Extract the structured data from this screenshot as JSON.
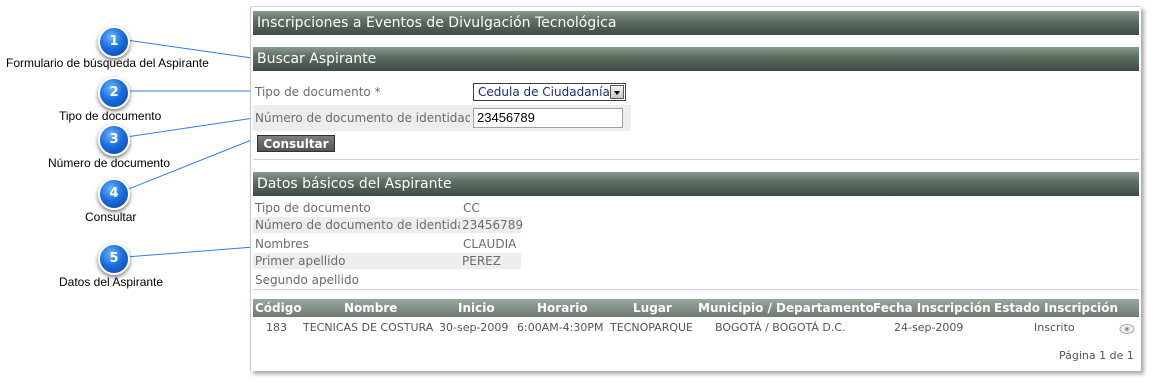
{
  "callouts": [
    {
      "number": "1",
      "caption": "Formulario de búsqueda del Aspirante"
    },
    {
      "number": "2",
      "caption": "Tipo de documento"
    },
    {
      "number": "3",
      "caption": "Número de documento"
    },
    {
      "number": "4",
      "caption": "Consultar"
    },
    {
      "number": "5",
      "caption": "Datos del Aspirante"
    }
  ],
  "app": {
    "title": "Inscripciones a Eventos de Divulgación Tecnológica"
  },
  "search": {
    "title": "Buscar Aspirante",
    "doc_type_label": "Tipo de documento *",
    "doc_type_value": "Cedula de Ciudadanía",
    "doc_number_label": "Número de documento de identidad *",
    "doc_number_value": "23456789",
    "submit_label": "Consultar"
  },
  "basic": {
    "title": "Datos básicos del Aspirante",
    "rows": [
      {
        "label": "Tipo de documento",
        "value": "CC"
      },
      {
        "label": "Número de documento de identidad",
        "value": "23456789"
      },
      {
        "label": "Nombres",
        "value": "CLAUDIA"
      },
      {
        "label": "Primer apellido",
        "value": "PEREZ"
      },
      {
        "label": "Segundo apellido",
        "value": ""
      }
    ]
  },
  "table": {
    "columns": [
      "Código",
      "Nombre",
      "Inicio",
      "Horario",
      "Lugar",
      "Municipio / Departamento",
      "Fecha Inscripción",
      "Estado Inscripción"
    ],
    "rows": [
      [
        "183",
        "TECNICAS DE COSTURA",
        "30-sep-2009",
        "6:00AM-4:30PM",
        "TECNOPARQUE",
        "BOGOTÁ / BOGOTÁ D.C.",
        "24-sep-2009",
        "Inscrito"
      ]
    ],
    "pagination": "Página 1 de 1",
    "row_icon": "eye-icon"
  }
}
